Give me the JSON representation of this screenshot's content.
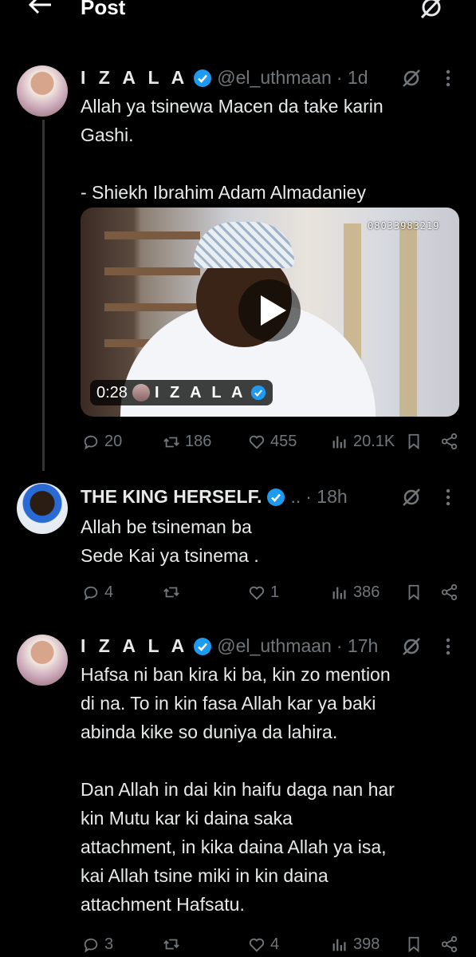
{
  "header": {
    "title": "Post"
  },
  "tweets": [
    {
      "display_name": "I Z A L A",
      "handle": "@el_uthmaan",
      "time": "· 1d",
      "body": "Allah ya tsinewa Macen da take karin\nGashi.\n\n- Shiekh Ibrahim Adam Almadaniey",
      "video": {
        "duration": "0:28",
        "author": "I Z A L A",
        "watermark": "08033983219"
      },
      "replies": "20",
      "reposts": "186",
      "likes": "455",
      "views": "20.1K"
    },
    {
      "display_name": "THE KING HERSELF.",
      "handle_truncated": "..",
      "time": "· 18h",
      "body": "Allah be tsineman ba\nSede Kai ya tsinema .",
      "replies": "4",
      "reposts": "",
      "likes": "1",
      "views": "386"
    },
    {
      "display_name": "I Z A L A",
      "handle": "@el_uthmaan",
      "time": "· 17h",
      "body": "Hafsa ni ban kira ki ba, kin zo mention\ndi na. To in kin fasa Allah kar ya baki\nabinda kike so duniya da lahira.\n\nDan Allah in dai kin haifu daga nan har\nkin Mutu kar ki daina saka\nattachment, in kika daina Allah ya isa,\nkai Allah tsine miki in kin daina\nattachment Hafsatu.",
      "replies": "3",
      "reposts": "",
      "likes": "4",
      "views": "398"
    }
  ],
  "colors": {
    "verified": "#1d9bf0",
    "muted": "#71767b",
    "text": "#e7e9ea",
    "background": "#000000"
  }
}
